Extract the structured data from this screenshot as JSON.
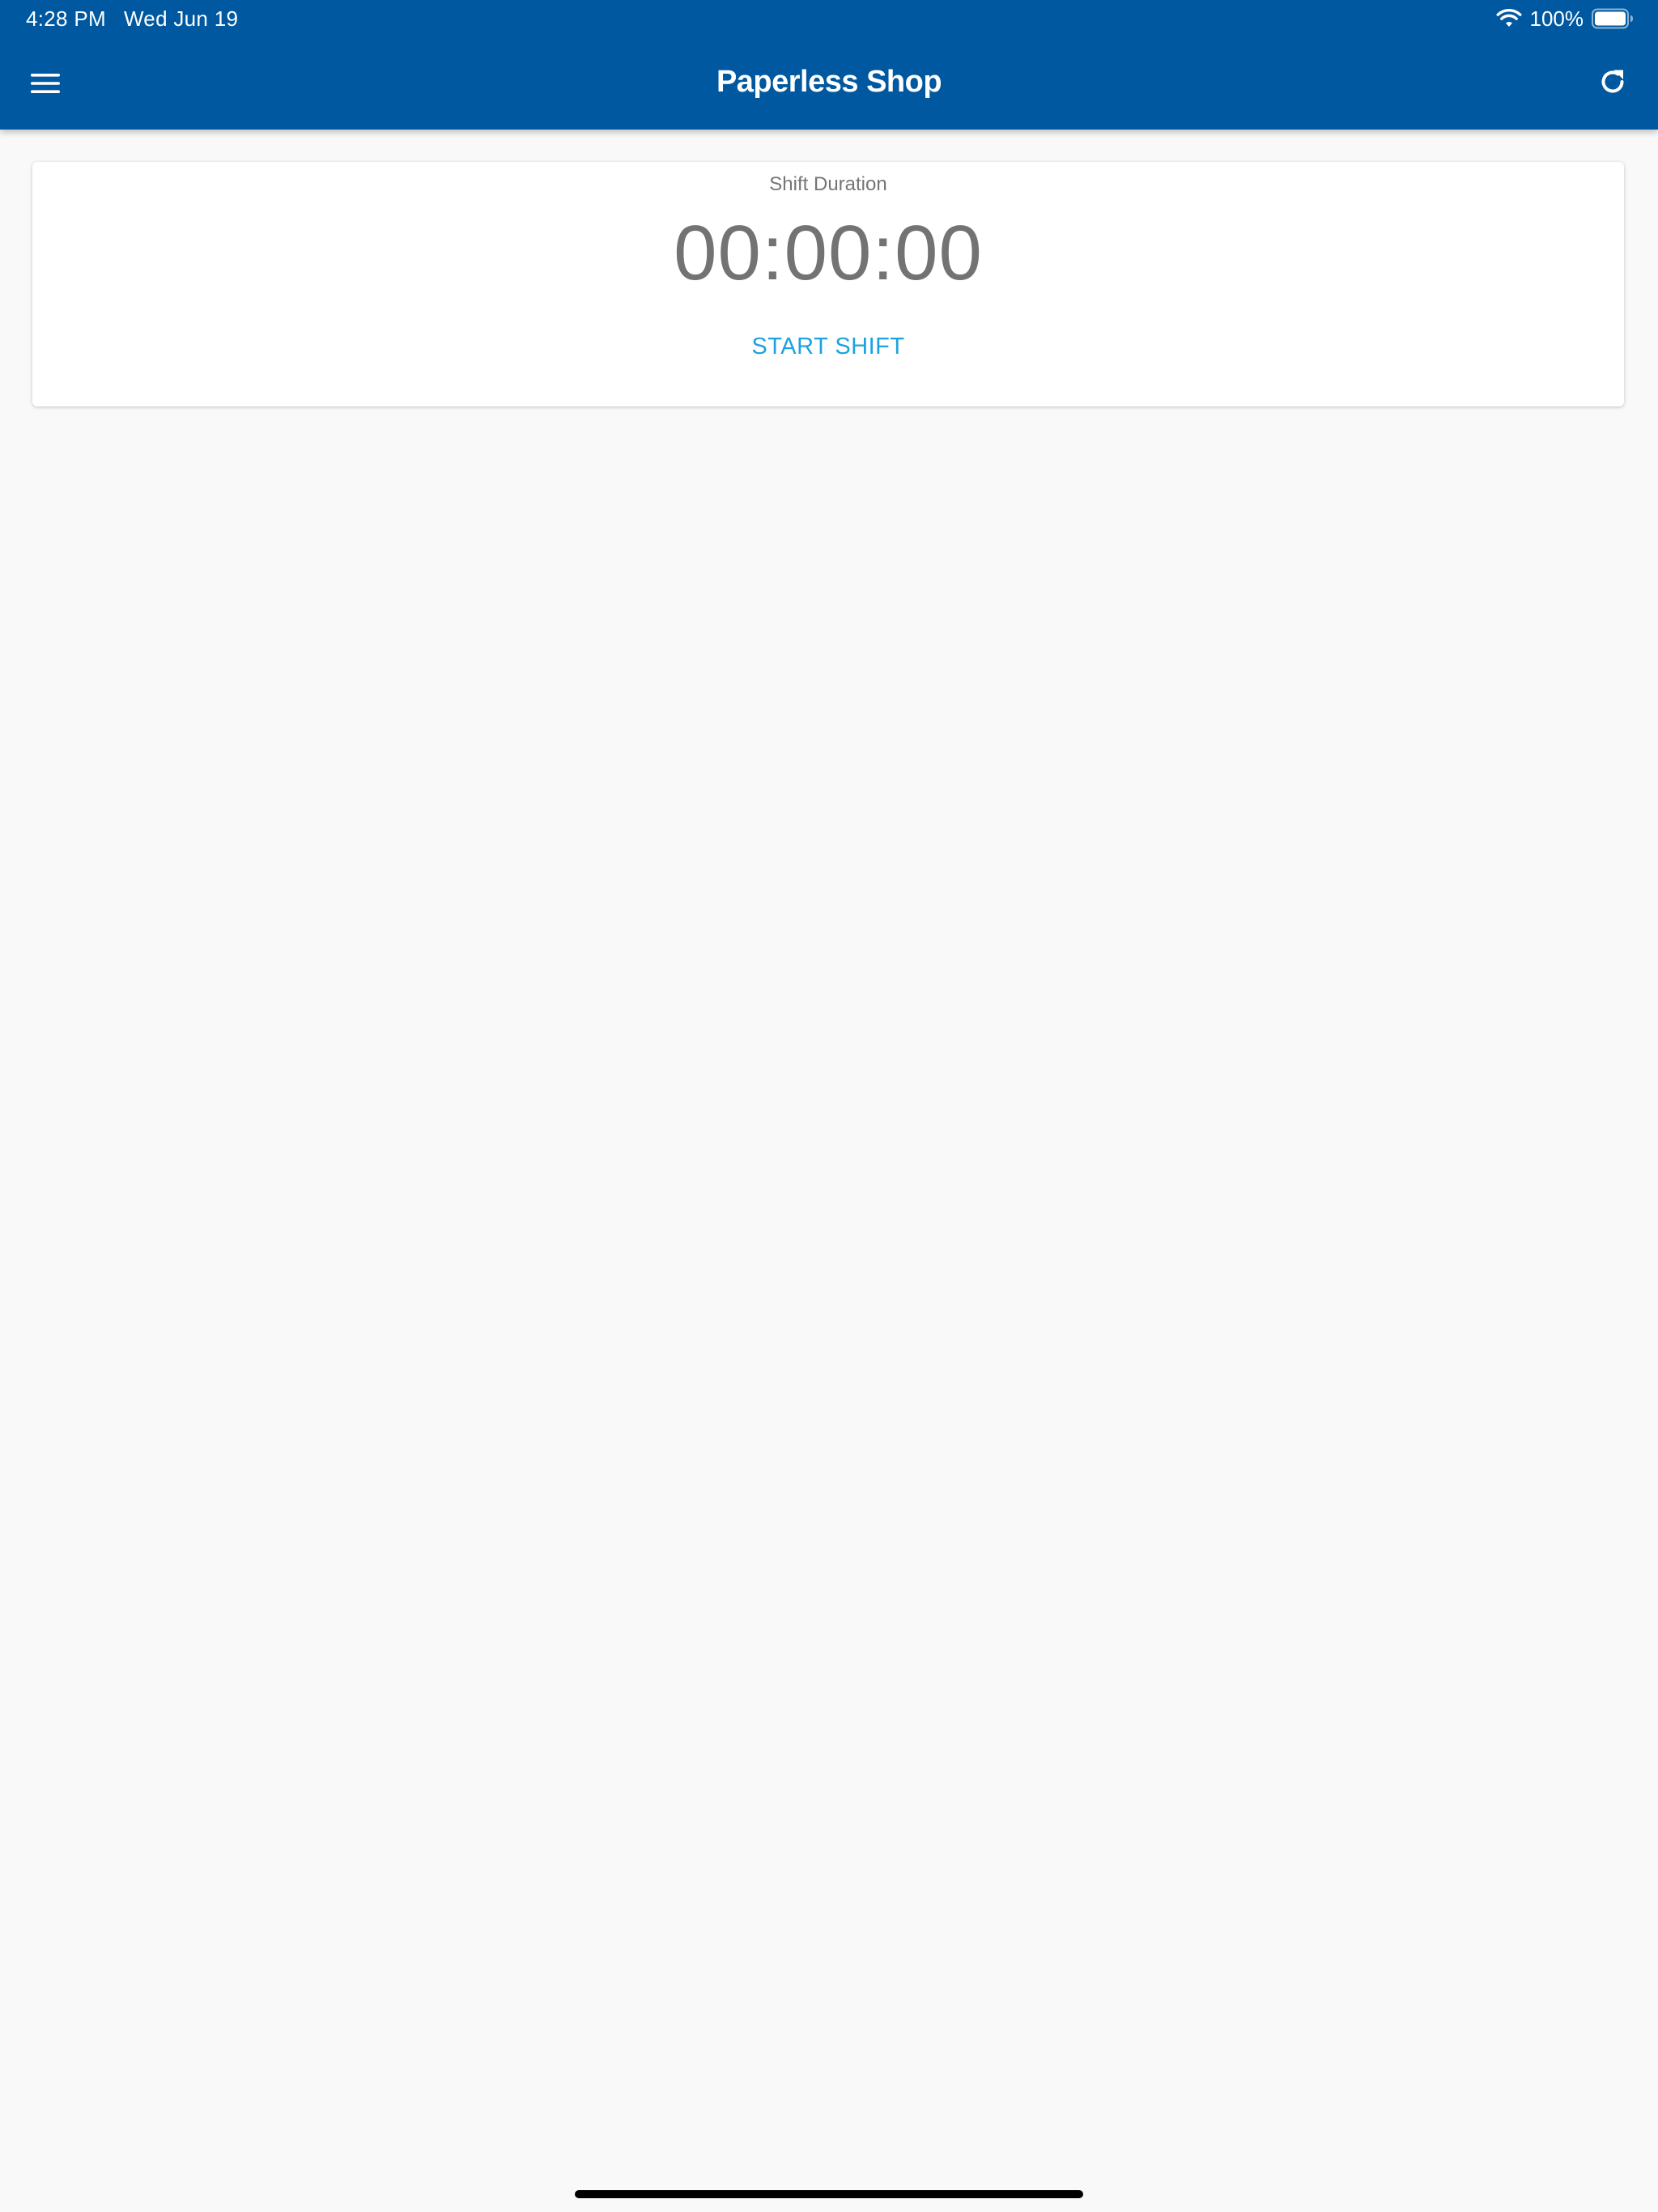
{
  "status_bar": {
    "time": "4:28 PM",
    "date": "Wed Jun 19",
    "battery_percent": "100%",
    "battery_level": 1.0,
    "wifi_icon": "wifi-icon",
    "battery_icon": "battery-icon"
  },
  "app_bar": {
    "title": "Paperless Shop",
    "menu_icon": "hamburger-menu-icon",
    "refresh_icon": "refresh-icon",
    "background_color": "#0059a0"
  },
  "shift_card": {
    "label": "Shift Duration",
    "duration": "00:00:00",
    "start_button_label": "START SHIFT",
    "accent_color": "#1ca2e0"
  }
}
